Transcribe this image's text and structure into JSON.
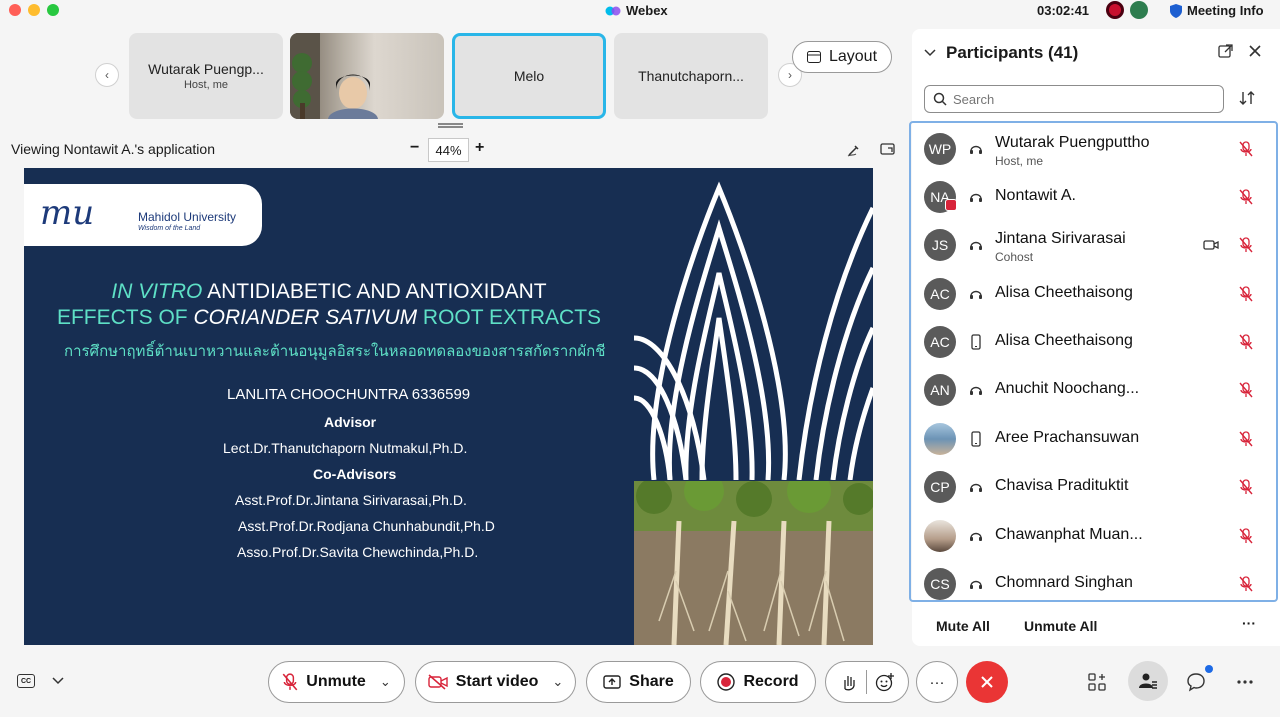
{
  "titlebar": {
    "app_name": "Webex",
    "clock": "03:02:41",
    "meeting_info": "Meeting Info"
  },
  "thumbnails": [
    {
      "name": "Wutarak Puengp...",
      "sub": "Host, me"
    },
    {
      "name": "",
      "sub": ""
    },
    {
      "name": "Melo",
      "sub": ""
    },
    {
      "name": "Thanutchaporn...",
      "sub": ""
    }
  ],
  "layout_button": "Layout",
  "sharing": {
    "viewing_text": "Viewing Nontawit A.'s application",
    "zoom_minus": "−",
    "zoom": "44%",
    "zoom_plus": "+"
  },
  "slide": {
    "logo_mark": "mu",
    "logo_text": "Mahidol University",
    "logo_motto": "Wisdom of the Land",
    "title_line1_italic": "IN VITRO",
    "title_line1_rest": " ANTIDIABETIC AND ANTIOXIDANT",
    "title_line2_pre": "EFFECTS OF ",
    "title_line2_italic": "CORIANDER SATIVUM",
    "title_line2_post": " ROOT EXTRACTS",
    "thai_title": "การศึกษาฤทธิ์ต้านเบาหวานและต้านอนุมูลอิสระในหลอดทดลองของสารสกัดรากผักชี",
    "author": "LANLITA CHOOCHUNTRA 6336599",
    "advisor_heading": "Advisor",
    "advisor": "Lect.Dr.Thanutchaporn Nutmakul,Ph.D.",
    "coadvisors_heading": "Co-Advisors",
    "coadvisors": [
      "Asst.Prof.Dr.Jintana Sirivarasai,Ph.D.",
      "Asst.Prof.Dr.Rodjana Chunhabundit,Ph.D",
      "Asso.Prof.Dr.Savita Chewchinda,Ph.D."
    ]
  },
  "participants": {
    "title": "Participants (41)",
    "search_placeholder": "Search",
    "list": [
      {
        "initials": "WP",
        "name": "Wutarak Puengputtho",
        "role": "Host, me",
        "device": "headset"
      },
      {
        "initials": "NA",
        "name": "Nontawit A.",
        "role": "",
        "device": "headset"
      },
      {
        "initials": "JS",
        "name": "Jintana Sirivarasai",
        "role": "Cohost",
        "device": "headset"
      },
      {
        "initials": "AC",
        "name": "Alisa Cheethaisong",
        "role": "",
        "device": "headset"
      },
      {
        "initials": "AC",
        "name": "Alisa Cheethaisong",
        "role": "",
        "device": "phone"
      },
      {
        "initials": "AN",
        "name": "Anuchit Noochang...",
        "role": "",
        "device": "headset"
      },
      {
        "initials": "",
        "name": "Aree Prachansuwan",
        "role": "",
        "device": "phone"
      },
      {
        "initials": "CP",
        "name": "Chavisa Pradituktit",
        "role": "",
        "device": "headset"
      },
      {
        "initials": "",
        "name": "Chawanphat Muan...",
        "role": "",
        "device": "headset"
      },
      {
        "initials": "CS",
        "name": "Chomnard Singhan",
        "role": "",
        "device": "headset"
      }
    ],
    "mute_all": "Mute All",
    "unmute_all": "Unmute All",
    "more": "···"
  },
  "controls": {
    "unmute": "Unmute",
    "start_video": "Start video",
    "share": "Share",
    "record": "Record",
    "more": "···"
  },
  "colors": {
    "accent": "#29b6e8",
    "slide_bg": "#172e52",
    "slide_title": "#5ee0c6",
    "end_call": "#ea3535",
    "mic_off": "#d8243a"
  }
}
